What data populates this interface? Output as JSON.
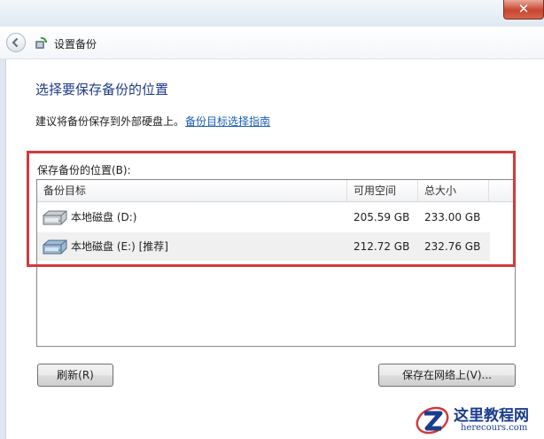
{
  "window": {
    "close_label": "✕"
  },
  "nav": {
    "title": "设置备份"
  },
  "page": {
    "heading": "选择要保存备份的位置",
    "hint_text": "建议将备份保存到外部硬盘上。",
    "hint_link": "备份目标选择指南",
    "list_label": "保存备份的位置(B):"
  },
  "list": {
    "columns": [
      "备份目标",
      "可用空间",
      "总大小"
    ],
    "rows": [
      {
        "name": "本地磁盘 (D:)",
        "free": "205.59 GB",
        "total": "233.00 GB",
        "icon": "hard-drive-icon"
      },
      {
        "name": "本地磁盘 (E:) [推荐]",
        "free": "212.72 GB",
        "total": "232.76 GB",
        "icon": "hard-drive-icon"
      }
    ]
  },
  "buttons": {
    "refresh": "刷新(R)",
    "save_network": "保存在网络上(V)..."
  },
  "watermark": {
    "title": "这里教程网",
    "url": "herecours.com"
  },
  "colors": {
    "highlight": "#d23a3a",
    "link": "#1a5fb4",
    "heading": "#1e3a8a"
  }
}
